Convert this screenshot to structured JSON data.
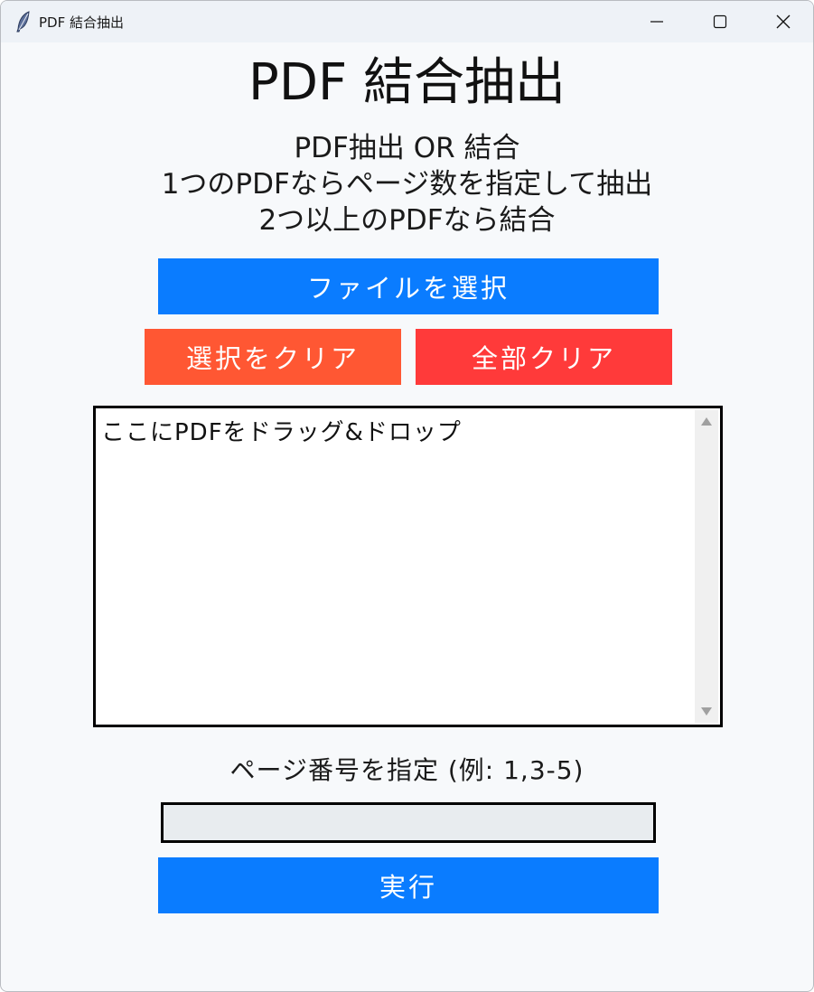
{
  "window": {
    "title": "PDF 結合抽出",
    "controls": {
      "minimize": "minimize",
      "maximize": "maximize",
      "close": "close"
    }
  },
  "main": {
    "heading": "PDF 結合抽出",
    "description": [
      "PDF抽出 OR 結合",
      "1つのPDFならページ数を指定して抽出",
      "2つ以上のPDFなら結合"
    ],
    "select_button": "ファイルを選択",
    "clear_selection_button": "選択をクリア",
    "clear_all_button": "全部クリア",
    "file_list": {
      "items": [
        "ここにPDFをドラッグ&ドロップ"
      ]
    },
    "page_label": "ページ番号を指定 (例: 1,3-5)",
    "page_input": {
      "value": "",
      "placeholder": ""
    },
    "run_button": "実行"
  },
  "colors": {
    "primary": "#0a7cff",
    "clear_selection": "#ff5733",
    "clear_all": "#ff3a3a",
    "background": "#f7f9fb",
    "titlebar": "#eef2f7"
  },
  "icons": {
    "app": "feather-icon",
    "minimize": "minimize-icon",
    "maximize": "maximize-icon",
    "close": "close-icon"
  }
}
